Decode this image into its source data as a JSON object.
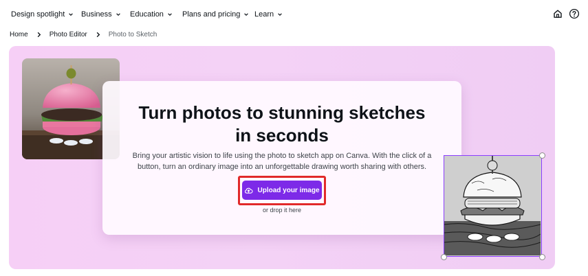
{
  "nav": {
    "items": [
      {
        "label": "Design spotlight"
      },
      {
        "label": "Business"
      },
      {
        "label": "Education"
      },
      {
        "label": "Plans and pricing"
      },
      {
        "label": "Learn"
      }
    ],
    "icons": [
      "home-icon",
      "help-icon"
    ]
  },
  "breadcrumb": {
    "home": "Home",
    "photo_editor": "Photo Editor",
    "current": "Photo to Sketch"
  },
  "hero": {
    "title_line1": "Turn photos to stunning sketches",
    "title_line2": "in seconds",
    "description_line1": "Bring your artistic vision to life using the photo to sketch app on Canva. With the click of a",
    "description_line2": "button, turn an ordinary image into an unforgettable drawing worth sharing with others.",
    "upload_label": "Upload your image",
    "drop_text": "or drop it here",
    "upload_icon": "cloud-upload-icon"
  },
  "colors": {
    "accent": "#7d2ae8",
    "highlight": "#e12a2a",
    "hero_background": "#f6cff6",
    "selection": "#8b3dff"
  }
}
